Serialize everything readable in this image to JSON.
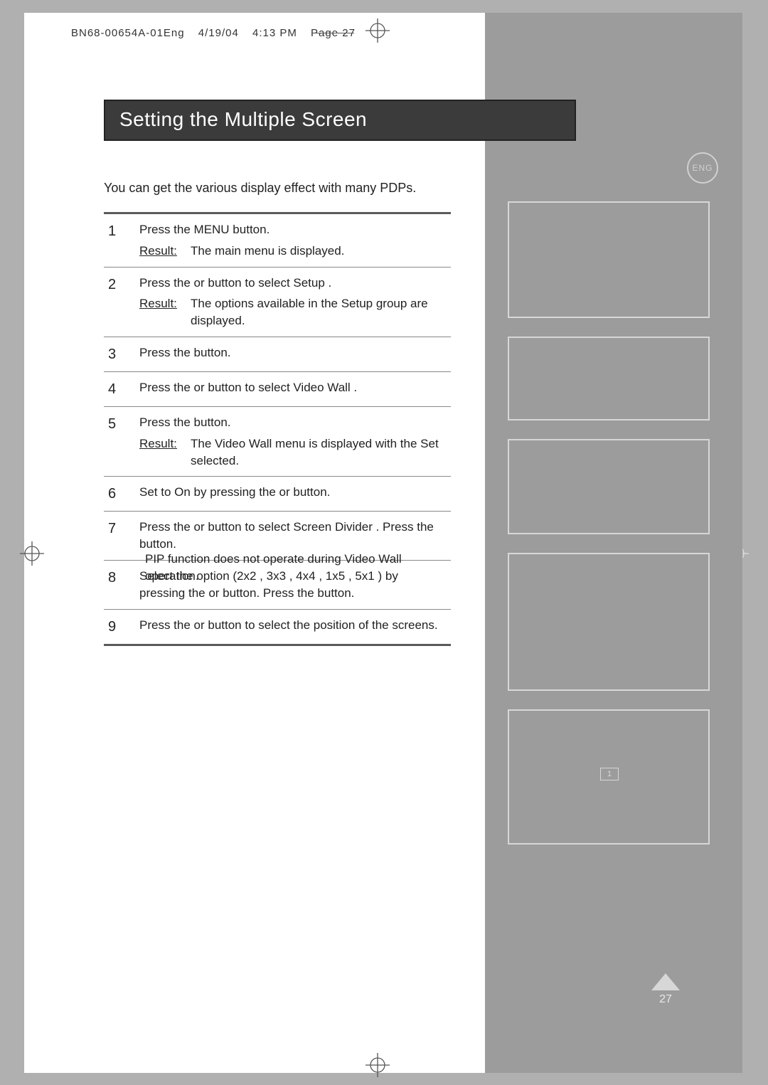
{
  "header": {
    "docid": "BN68-00654A-01Eng",
    "date": "4/19/04",
    "time": "4:13 PM",
    "page_label": "Page 27"
  },
  "title": "Setting the Multiple Screen",
  "intro": "You can get the various display effect with many PDPs.",
  "eng_badge": "ENG",
  "result_label": "Result:",
  "steps": [
    {
      "num": "1",
      "text": "Press the MENU button.",
      "result": "The main menu is displayed."
    },
    {
      "num": "2",
      "text": "Press the    or    button to select Setup .",
      "result": "The options available in the Setup  group are displayed."
    },
    {
      "num": "3",
      "text": "Press the    button."
    },
    {
      "num": "4",
      "text": "Press the    or    button to select Video Wall    ."
    },
    {
      "num": "5",
      "text": "Press the    button.",
      "result": "The Video Wall     menu is displayed with the Set selected."
    },
    {
      "num": "6",
      "text": "Set to On by pressing the    or    button."
    },
    {
      "num": "7",
      "text": "Press the    or    button to select Screen Divider     . Press the button."
    },
    {
      "num": "8",
      "text": "Select the option (2x2 , 3x3 , 4x4 , 1x5 , 5x1 ) by pressing the    or    button. Press the    button."
    },
    {
      "num": "9",
      "text": "Press the    or    button to select the position of the screens."
    }
  ],
  "note": "PIP function does not operate during Video Wall operation.",
  "thumb5_badge": "1",
  "page_number": "27"
}
